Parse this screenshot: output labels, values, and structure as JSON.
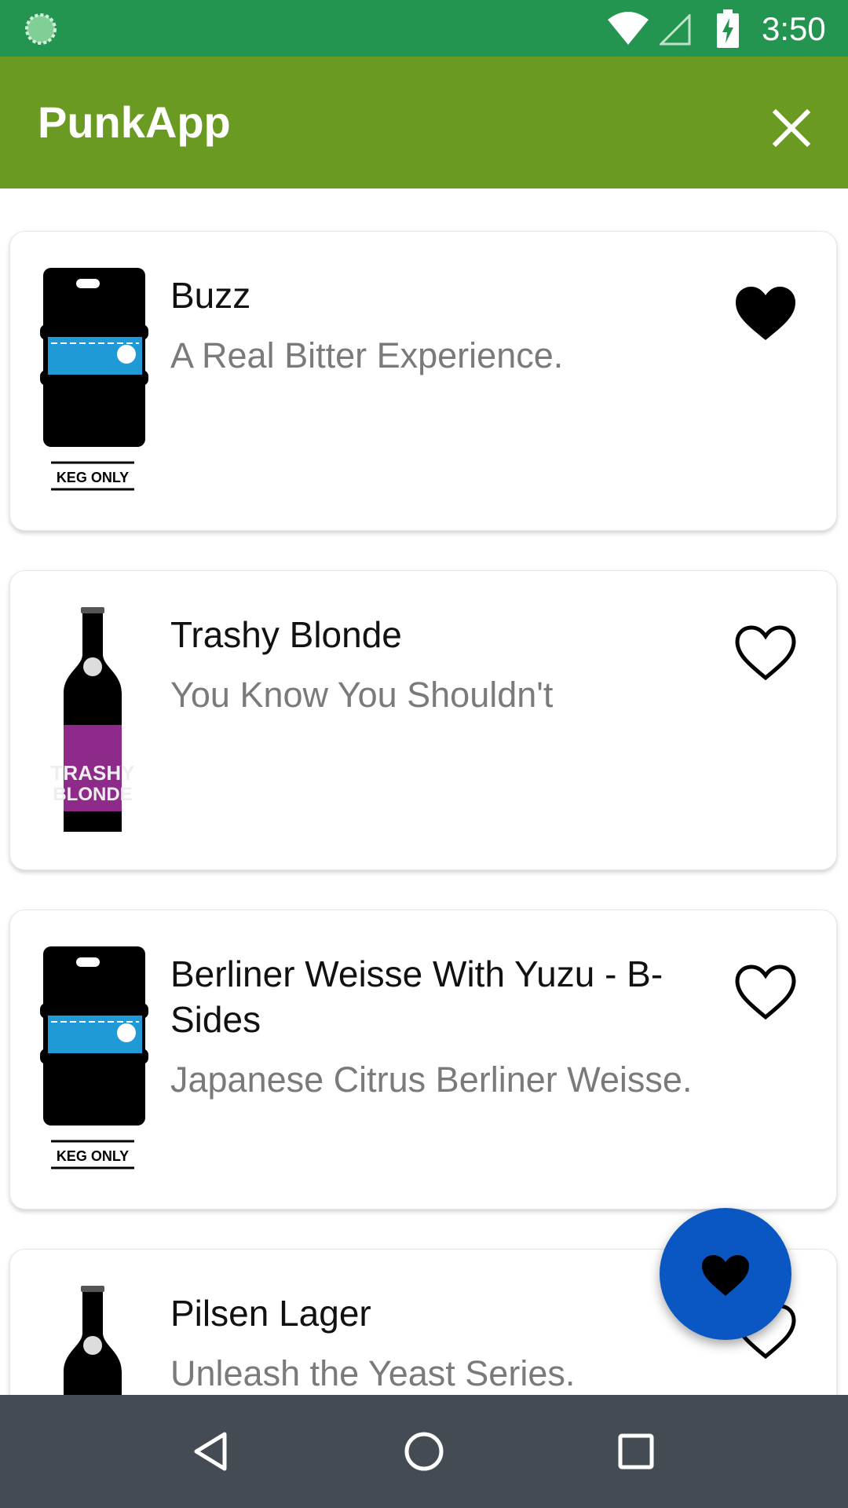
{
  "status_bar": {
    "time": "3:50",
    "icons": [
      "progress-circle-icon",
      "wifi-icon",
      "cell-signal-icon",
      "battery-charging-icon"
    ]
  },
  "app_bar": {
    "title": "PunkApp",
    "close_icon": "close-icon"
  },
  "beers": [
    {
      "name": "Buzz",
      "tagline": "A Real Bitter Experience.",
      "favorite": true,
      "image": "keg",
      "image_label": "KEG ONLY"
    },
    {
      "name": "Trashy Blonde",
      "tagline": "You Know You Shouldn't",
      "favorite": false,
      "image": "bottle"
    },
    {
      "name": "Berliner Weisse With Yuzu - B-Sides",
      "tagline": "Japanese Citrus Berliner Weisse.",
      "favorite": false,
      "image": "keg",
      "image_label": "KEG ONLY"
    },
    {
      "name": "Pilsen Lager",
      "tagline": "Unleash the Yeast Series.",
      "favorite": false,
      "image": "bottle"
    }
  ],
  "fab": {
    "icon": "heart-filled-icon"
  },
  "nav_bar": {
    "buttons": [
      "back-icon",
      "home-icon",
      "recents-icon"
    ]
  },
  "colors": {
    "status_bar": "#239550",
    "app_bar": "#6b9a22",
    "fab": "#0a56c2",
    "nav_bar": "#454b52",
    "tagline": "#7a7a7a"
  }
}
